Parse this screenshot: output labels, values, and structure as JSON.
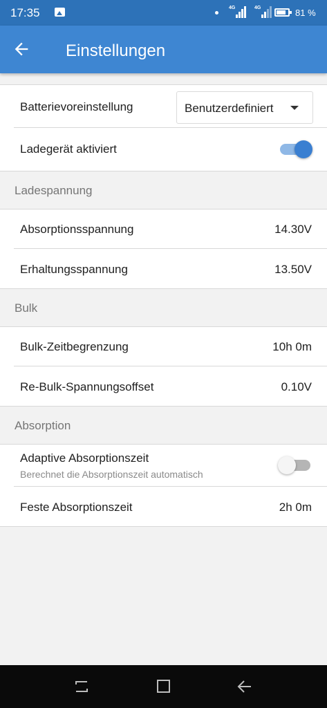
{
  "statusbar": {
    "time": "17:35",
    "battery_pct": "81 %",
    "net1": "4G",
    "net2": "4G",
    "battery_level": 0.81
  },
  "appbar": {
    "title": "Einstellungen"
  },
  "top": {
    "battery_preset_label": "Batterievoreinstellung",
    "battery_preset_value": "Benutzerdefiniert",
    "charger_enabled_label": "Ladegerät aktiviert",
    "charger_enabled": true
  },
  "charge_voltage": {
    "header": "Ladespannung",
    "absorption_label": "Absorptionsspannung",
    "absorption_value": "14.30V",
    "float_label": "Erhaltungsspannung",
    "float_value": "13.50V"
  },
  "bulk": {
    "header": "Bulk",
    "time_limit_label": "Bulk-Zeitbegrenzung",
    "time_limit_value": "10h 0m",
    "rebulk_label": "Re-Bulk-Spannungsoffset",
    "rebulk_value": "0.10V"
  },
  "absorption": {
    "header": "Absorption",
    "adaptive_label": "Adaptive Absorptionszeit",
    "adaptive_sublabel": "Berechnet die Absorptionszeit automatisch",
    "adaptive_enabled": false,
    "fixed_label": "Feste Absorptionszeit",
    "fixed_value": "2h 0m"
  },
  "colors": {
    "statusbar": "#2d72b8",
    "appbar": "#3e86d2",
    "accent": "#3a7fd1"
  },
  "icons": {
    "back": "arrow-left-icon",
    "recents": "recents-icon",
    "home": "home-icon",
    "nav_back": "nav-back-icon"
  }
}
